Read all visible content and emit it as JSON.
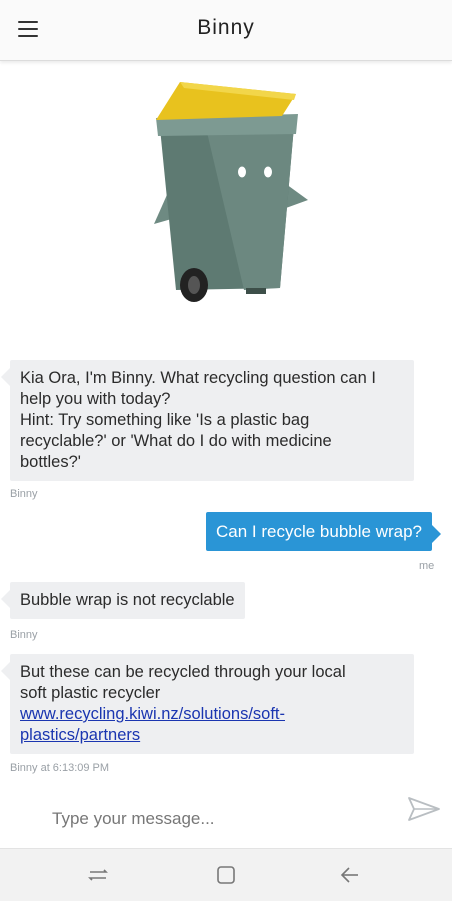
{
  "header": {
    "title": "Binny",
    "menu_icon": "hamburger-menu-icon"
  },
  "mascot": {
    "icon": "wheelie-bin-mascot",
    "lid_color": "#e8c21e",
    "body_color": "#5e7a72"
  },
  "messages": [
    {
      "sender": "Binny",
      "text_lines": [
        "Kia Ora, I'm Binny. What recycling question can I",
        "help you with today?",
        "Hint: Try something like 'Is a plastic bag",
        "recyclable?' or 'What do I do with medicine",
        "bottles?'"
      ],
      "meta": "Binny"
    },
    {
      "sender": "me",
      "text": "Can I recycle bubble wrap?",
      "meta": "me"
    },
    {
      "sender": "Binny",
      "text": "Bubble wrap is not recyclable",
      "meta": "Binny"
    },
    {
      "sender": "Binny",
      "text_lines": [
        "But these can be recycled through your local",
        "soft plastic recycler"
      ],
      "link_lines": [
        "www.recycling.kiwi.nz/solutions/soft-",
        "plastics/partners"
      ],
      "meta": "Binny at 6:13:09 PM"
    }
  ],
  "composer": {
    "placeholder": "Type your message...",
    "value": "",
    "send_icon": "send-icon"
  },
  "nav": {
    "recents_icon": "recents-icon",
    "home_icon": "home-icon",
    "back_icon": "back-icon"
  },
  "colors": {
    "accent": "#2a95d6",
    "bot_bubble": "#eeeff1",
    "link": "#1a35b0"
  }
}
